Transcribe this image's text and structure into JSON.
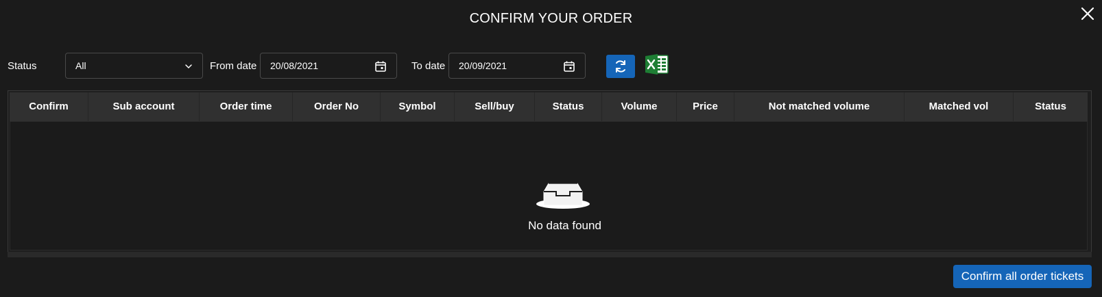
{
  "dialog": {
    "title": "CONFIRM YOUR ORDER",
    "close_icon": "close-icon"
  },
  "filters": {
    "status_label": "Status",
    "status_value": "All",
    "from_label": "From date",
    "from_value": "20/08/2021",
    "to_label": "To date",
    "to_value": "20/09/2021",
    "refresh_icon": "refresh-icon",
    "excel_icon": "excel-export-icon"
  },
  "table": {
    "columns": [
      "Confirm",
      "Sub account",
      "Order time",
      "Order No",
      "Symbol",
      "Sell/buy",
      "Status",
      "Volume",
      "Price",
      "Not matched volume",
      "Matched vol",
      "Status"
    ],
    "empty_text": "No data found",
    "empty_icon": "empty-inbox-icon"
  },
  "footer": {
    "confirm_all_label": "Confirm all order tickets"
  },
  "colors": {
    "background": "#1b1b1b",
    "header_bg": "#303030",
    "accent_blue": "#1565b8",
    "excel_green": "#1e7e34"
  }
}
